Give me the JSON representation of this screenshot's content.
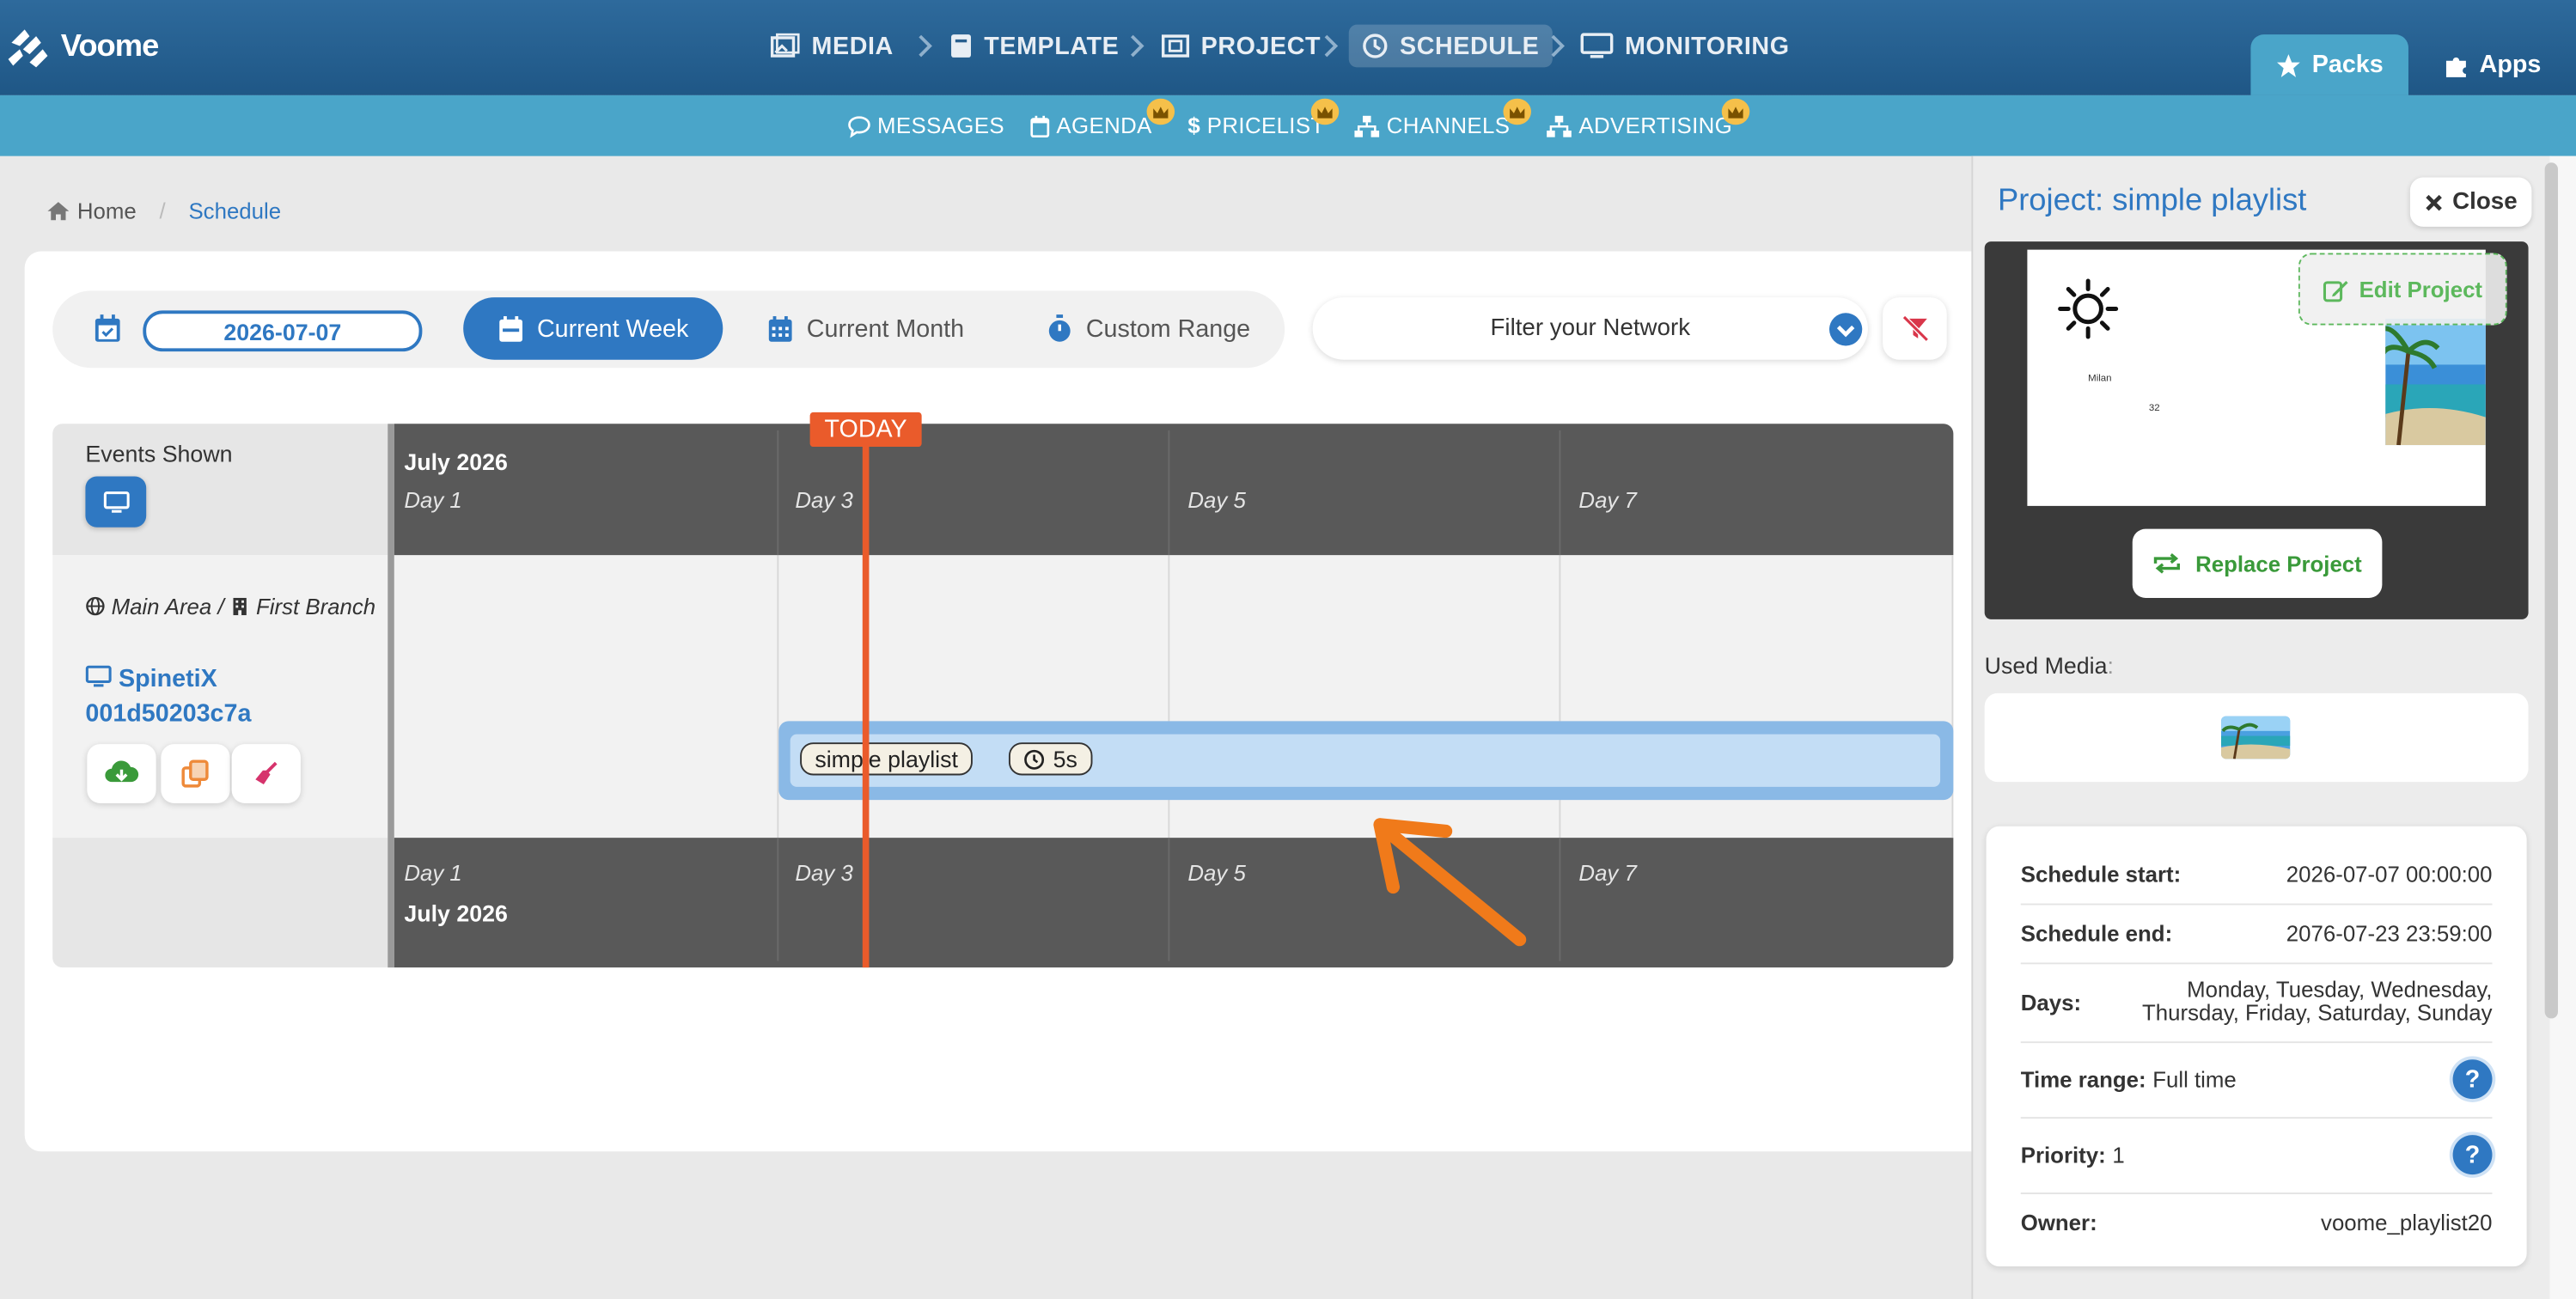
{
  "app": {
    "name": "Voome"
  },
  "nav": {
    "items": [
      {
        "label": "MEDIA",
        "icon": "images-icon"
      },
      {
        "label": "TEMPLATE",
        "icon": "book-icon"
      },
      {
        "label": "PROJECT",
        "icon": "project-icon"
      },
      {
        "label": "SCHEDULE",
        "icon": "clock-icon",
        "active": true
      },
      {
        "label": "MONITORING",
        "icon": "monitor-icon"
      }
    ],
    "right_tabs": [
      {
        "label": "Packs",
        "icon": "star-icon"
      },
      {
        "label": "Apps",
        "icon": "puzzle-icon"
      }
    ]
  },
  "subnav": {
    "items": [
      {
        "label": "MESSAGES",
        "icon": "chat-icon",
        "crown": false
      },
      {
        "label": "AGENDA",
        "icon": "calendar-icon",
        "crown": true
      },
      {
        "label": "PRICELIST",
        "icon": "dollar-icon",
        "crown": true
      },
      {
        "label": "CHANNELS",
        "icon": "sitemap-icon",
        "crown": true
      },
      {
        "label": "ADVERTISING",
        "icon": "sitemap-icon",
        "crown": true
      }
    ]
  },
  "breadcrumb": {
    "home": "Home",
    "current": "Schedule"
  },
  "toolbar": {
    "date": "2026-07-07",
    "current_week": "Current Week",
    "current_month": "Current Month",
    "custom_range": "Custom Range",
    "filter_placeholder": "Filter your Network"
  },
  "timeline": {
    "events_shown": "Events Shown",
    "month": "July 2026",
    "days": [
      "Day 1",
      "Day 3",
      "Day 5",
      "Day 7"
    ],
    "today": "TODAY",
    "location": {
      "area": "Main Area",
      "separator": "/",
      "branch": "First Branch"
    },
    "device": {
      "name": "SpinetiX",
      "id": "001d50203c7a"
    },
    "event": {
      "name": "simple playlist",
      "duration": "5s"
    }
  },
  "panel": {
    "title": "Project: simple playlist",
    "close": "Close",
    "edit_project": "Edit Project",
    "replace_project": "Replace Project",
    "preview": {
      "city": "Milan",
      "temp": "32"
    },
    "used_media_label": "Used Media",
    "used_media_colon": ":",
    "info": {
      "schedule_start": {
        "label": "Schedule start:",
        "value": "2026-07-07 00:00:00"
      },
      "schedule_end": {
        "label": "Schedule end:",
        "value": "2076-07-23 23:59:00"
      },
      "days": {
        "label": "Days:",
        "value_line1": "Monday, Tuesday, Wednesday,",
        "value_line2": "Thursday, Friday, Saturday, Sunday"
      },
      "time_range": {
        "label": "Time range:",
        "value": "Full time"
      },
      "priority": {
        "label": "Priority:",
        "value": "1"
      },
      "owner": {
        "label": "Owner:",
        "value": "voome_playlist20"
      }
    }
  },
  "colors": {
    "primary": "#2f78c2",
    "topbar": "#24608f",
    "subbar": "#4aa5c9",
    "today": "#ea5b2b",
    "timeline_header": "#595959",
    "event": "#8ab9e6",
    "success": "#3a9a3a",
    "annotation_arrow": "#f07a1a"
  }
}
